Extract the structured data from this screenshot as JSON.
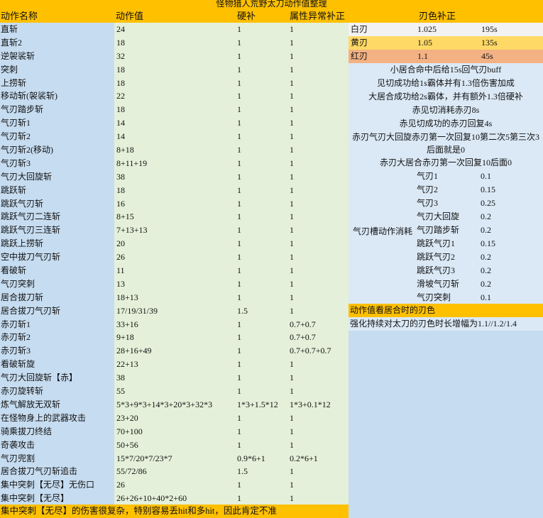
{
  "title": "怪物猎人荒野太刀动作值整理",
  "headers": [
    "动作名称",
    "动作值",
    "硬补",
    "属性异常补正"
  ],
  "blade_header": "刃色补正",
  "rows": [
    [
      "直斩",
      "24",
      "1",
      "1"
    ],
    [
      "直斩2",
      "18",
      "1",
      "1"
    ],
    [
      "逆袈裟斩",
      "32",
      "1",
      "1"
    ],
    [
      "突刺",
      "18",
      "1",
      "1"
    ],
    [
      "上捞斩",
      "18",
      "1",
      "1"
    ],
    [
      "移动斩(袈裟斩)",
      "22",
      "1",
      "1"
    ],
    [
      "气刃踏步斩",
      "18",
      "1",
      "1"
    ],
    [
      "气刃斩1",
      "14",
      "1",
      "1"
    ],
    [
      "气刃斩2",
      "14",
      "1",
      "1"
    ],
    [
      "气刃斩2(移动)",
      "8+18",
      "1",
      "1"
    ],
    [
      "气刃斩3",
      "8+11+19",
      "1",
      "1"
    ],
    [
      "气刃大回旋斩",
      "38",
      "1",
      "1"
    ],
    [
      "跳跃斩",
      "18",
      "1",
      "1"
    ],
    [
      "跳跃气刃斩",
      "16",
      "1",
      "1"
    ],
    [
      "跳跃气刃二连斩",
      "8+15",
      "1",
      "1"
    ],
    [
      "跳跃气刃三连斩",
      "7+13+13",
      "1",
      "1"
    ],
    [
      "跳跃上捞斩",
      "20",
      "1",
      "1"
    ],
    [
      "空中拔刀气刃斩",
      "26",
      "1",
      "1"
    ],
    [
      "看破斩",
      "11",
      "1",
      "1"
    ],
    [
      "气刃突刺",
      "13",
      "1",
      "1"
    ],
    [
      "居合拔刀斩",
      "18+13",
      "1",
      "1"
    ],
    [
      "居合拔刀气刃斩",
      "17/19/31/39",
      "1.5",
      "1"
    ],
    [
      "赤刃斩1",
      "33+16",
      "1",
      "0.7+0.7"
    ],
    [
      "赤刃斩2",
      "9+18",
      "1",
      "0.7+0.7"
    ],
    [
      "赤刃斩3",
      "28+16+49",
      "1",
      "0.7+0.7+0.7"
    ],
    [
      "看破斩旋",
      "22+13",
      "1",
      "1"
    ],
    [
      "气刃大回旋斩【赤】",
      "38",
      "1",
      "1"
    ],
    [
      "赤刃旋转斩",
      "55",
      "1",
      "1"
    ],
    [
      "炼气解放无双斩",
      "5*3+9*3+14*3+20*3+32*3",
      "1*3+1.5*12",
      "1*3+0.1*12"
    ],
    [
      "在怪物身上的武器攻击",
      "23+20",
      "1",
      "1"
    ],
    [
      "骑乘拔刀终结",
      "70+100",
      "1",
      "1"
    ],
    [
      "奇袭攻击",
      "50+56",
      "1",
      "1"
    ],
    [
      "气刃兜割",
      "15*7/20*7/23*7",
      "0.9*6+1",
      "0.2*6+1"
    ],
    [
      "居合拔刀气刃斩追击",
      "55/72/86",
      "1.5",
      "1"
    ],
    [
      "集中突刺【无尽】无伤口",
      "26",
      "1",
      "1"
    ],
    [
      "集中突刺【无尽】",
      "26+26+10+40*2+60",
      "1",
      "1"
    ]
  ],
  "footer": "集中突刺【无尽】的伤害很复杂，特别容易丢hit和多hit，因此肯定不准",
  "blades": [
    {
      "name": "白刃",
      "mult": "1.025",
      "dur": "195s",
      "color": "#f2f2f2"
    },
    {
      "name": "黄刃",
      "mult": "1.05",
      "dur": "135s",
      "color": "#ffd966"
    },
    {
      "name": "红刃",
      "mult": "1.1",
      "dur": "45s",
      "color": "#f4b183"
    }
  ],
  "notes": [
    "小居合命中后给15s回气刃buff",
    "见切成功给1s霸体并有1.3倍伤害加成",
    "大居合成功给2s霸体，并有额外1.3倍硬补",
    "赤见切消耗赤刃8s",
    "赤见切成功的赤刃回复4s",
    "赤刃气刃大回旋赤刃第一次回复10第二次5第三次3后面就是0",
    "赤刃大居合赤刃第一次回复10后面0"
  ],
  "gauge_label": "气刃槽动作消耗",
  "gauge": [
    [
      "气刃1",
      "0.1"
    ],
    [
      "气刃2",
      "0.15"
    ],
    [
      "气刃3",
      "0.25"
    ],
    [
      "气刃大回旋",
      "0.2"
    ],
    [
      "气刃踏步斩",
      "0.2"
    ],
    [
      "跳跃气刃1",
      "0.15"
    ],
    [
      "跳跃气刃2",
      "0.2"
    ],
    [
      "跳跃气刃3",
      "0.2"
    ],
    [
      "滑坡气刃斩",
      "0.2"
    ],
    [
      "气刃突刺",
      "0.1"
    ]
  ],
  "note_orange": "动作值看居合时的刃色",
  "note_last": "强化持续对太刀的刃色时长增幅为1.1//1.2/1.4"
}
